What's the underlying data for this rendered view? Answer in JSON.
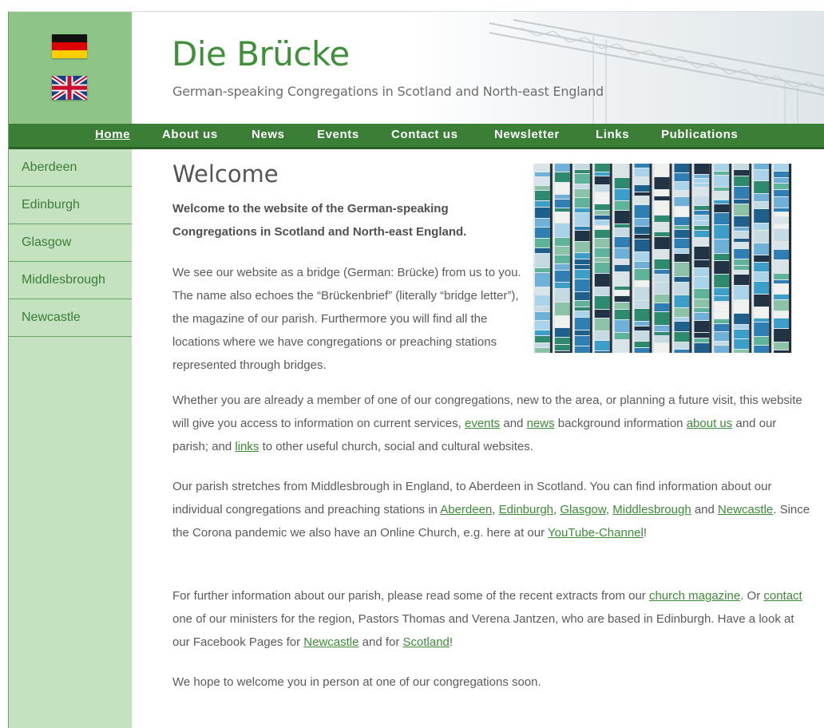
{
  "header": {
    "title": "Die Brücke",
    "subtitle": "German-speaking Congregations in Scotland and North-east England"
  },
  "nav": {
    "items": [
      {
        "label": "Home"
      },
      {
        "label": "About us"
      },
      {
        "label": "News"
      },
      {
        "label": "Events"
      },
      {
        "label": "Contact us"
      },
      {
        "label": "Newsletter"
      },
      {
        "label": "Links"
      },
      {
        "label": "Publications"
      }
    ]
  },
  "sidebar": {
    "items": [
      {
        "label": "Aberdeen"
      },
      {
        "label": "Edinburgh"
      },
      {
        "label": "Glasgow"
      },
      {
        "label": "Middlesbrough"
      },
      {
        "label": "Newcastle"
      }
    ]
  },
  "main": {
    "heading": "Welcome",
    "intro": "Welcome to the website of the German-speaking Congregations in Scotland and North-east England.",
    "p1": "We see our website as a bridge (German: Brücke) from us to you. The name also echoes the “Brückenbrief” (literally “bridge letter”), the magazine of our parish. Furthermore you will find all the locations where we have congregations or preaching stations represented through bridges.",
    "p2": {
      "t1": "Whether you are already a member of one of our congregations, new to the area, or planning a future visit, this website will give you access to information on current services, ",
      "l1": "events",
      "t2": " and ",
      "l2": "news",
      "t3": " background information ",
      "l3": "about us",
      "t4": " and our parish; and ",
      "l4": "links",
      "t5": " to other useful church, social and cultural websites."
    },
    "p3": {
      "t1": "Our parish stretches from Middlesbrough in England, to Aberdeen in Scotland. You can find information about our individual congregations and preaching stations in ",
      "l1": "Aberdeen",
      "t2": ", ",
      "l2": "Edinburgh",
      "t3": ", ",
      "l3": "Glasgow",
      "t4": ", ",
      "l4": "Middlesbrough",
      "t5": " and ",
      "l5": "Newcastle",
      "t6": ". Since the Corona pandemic we also have an Online Church, e.g. here at our ",
      "l6": "YouTube-Channel",
      "t7": "!"
    },
    "p4": {
      "t1": "For further information about our parish, please read some of the recent extracts from our ",
      "l1": "church magazine",
      "t2": ". Or ",
      "l2": "contact",
      "t3": " one of our ministers for the region, Pastors Thomas and Verena Jantzen, who are based in Edinburgh. Have a look at our Facebook Pages for ",
      "l3": "Newcastle",
      "t4": " and for ",
      "l4": "Scotland",
      "t5": "!"
    },
    "p5": "We hope to welcome you in person at one of our congregations soon."
  },
  "colors": {
    "brand_green": "#3f8f3b",
    "nav_green": "#3a7f35",
    "sidebar_green": "#c5e2c0",
    "flag_column_green": "#8cc587"
  },
  "icons": {
    "german_flag": "german-flag-icon",
    "uk_flag": "uk-flag-icon"
  }
}
